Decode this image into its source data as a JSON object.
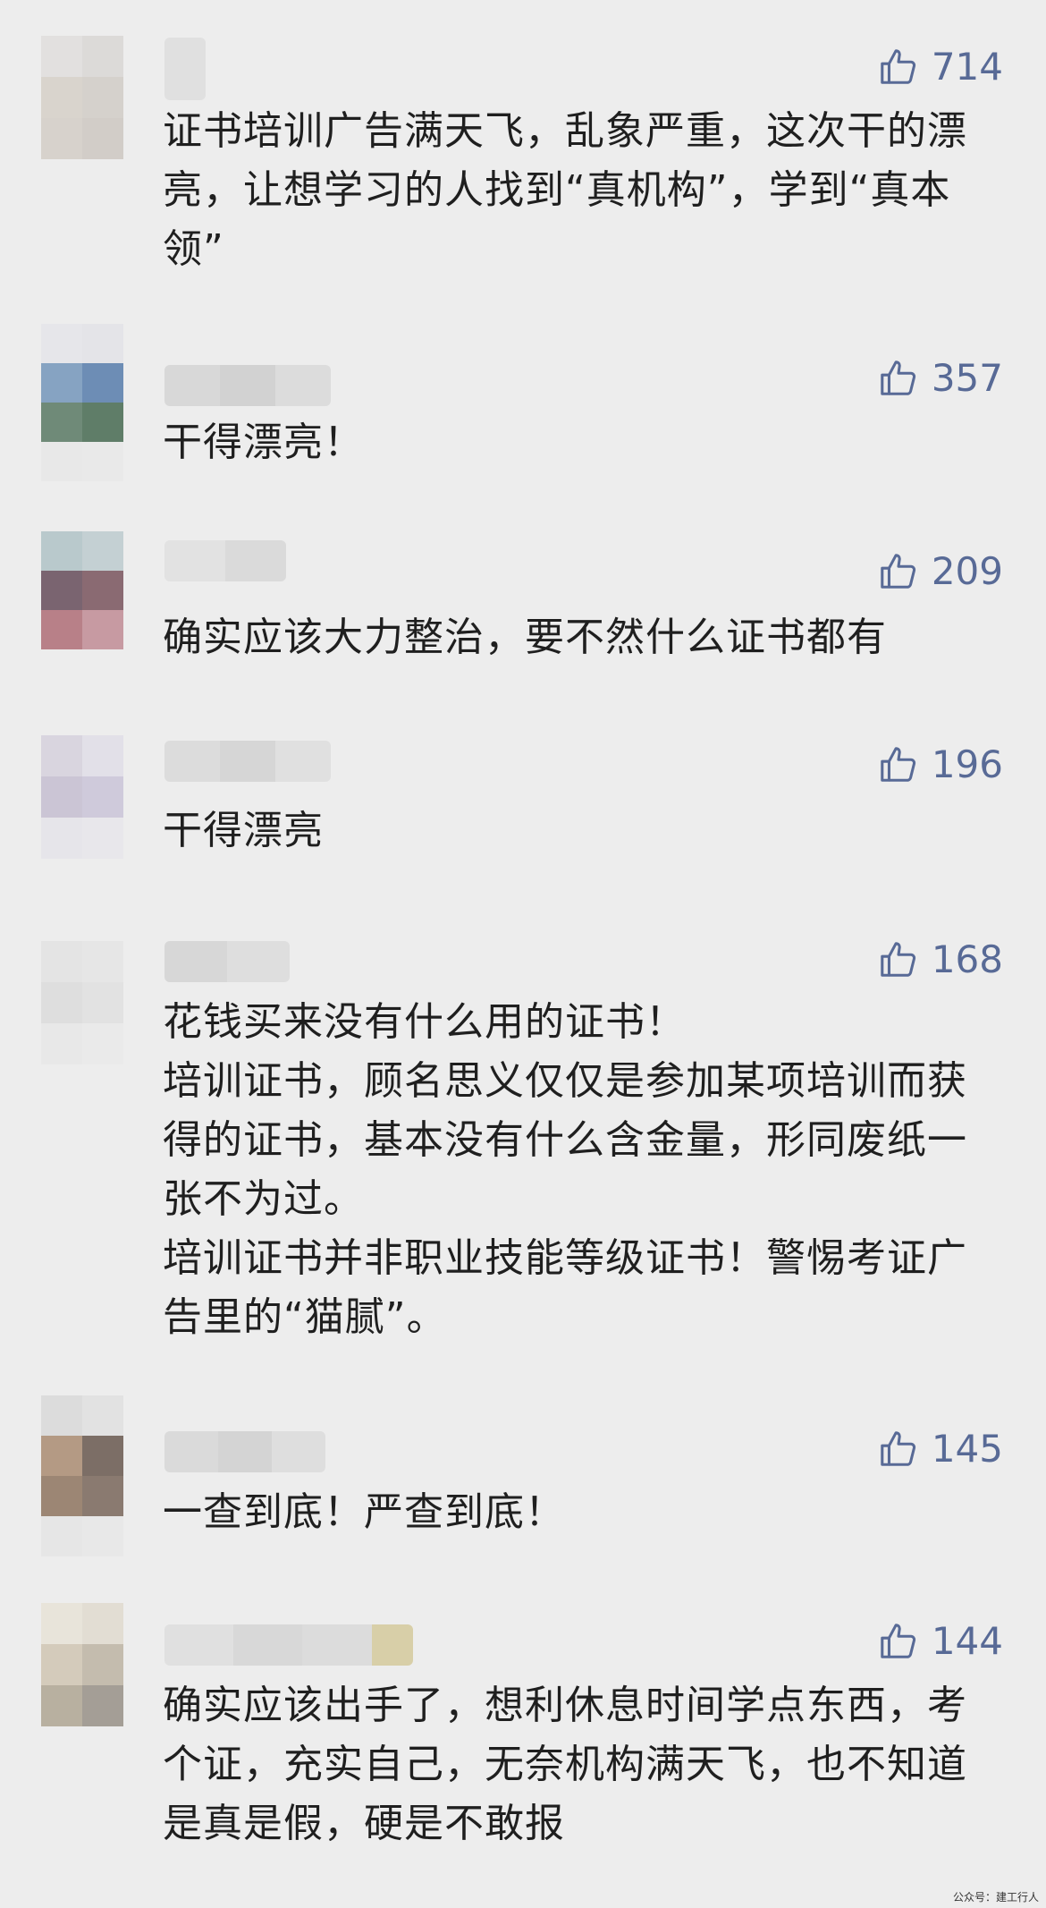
{
  "comments": [
    {
      "likes": "714",
      "text": "证书培训广告满天飞，乱象严重，这次干的漂亮，让想学习的人找到“真机构”，学到“真本领”"
    },
    {
      "likes": "357",
      "text": "干得漂亮！"
    },
    {
      "likes": "209",
      "text": "确实应该大力整治，要不然什么证书都有"
    },
    {
      "likes": "196",
      "text": "干得漂亮"
    },
    {
      "likes": "168",
      "text": "花钱买来没有什么用的证书！\n培训证书，顾名思义仅仅是参加某项培训而获得的证书，基本没有什么含金量，形同废纸一张不为过。\n培训证书并非职业技能等级证书！警惕考证广告里的“猫腻”。"
    },
    {
      "likes": "145",
      "text": "一查到底！严查到底！"
    },
    {
      "likes": "144",
      "text": "确实应该出手了，想利休息时间学点东西，考个证，充实自己，无奈机构满天飞，也不知道是真是假，硬是不敢报"
    }
  ],
  "like_icon": "thumbs-up-icon",
  "colors": {
    "background": "#ededed",
    "like_count": "#586a96",
    "comment_text": "#1f1f1f"
  },
  "watermark": "公众号：建工行人"
}
